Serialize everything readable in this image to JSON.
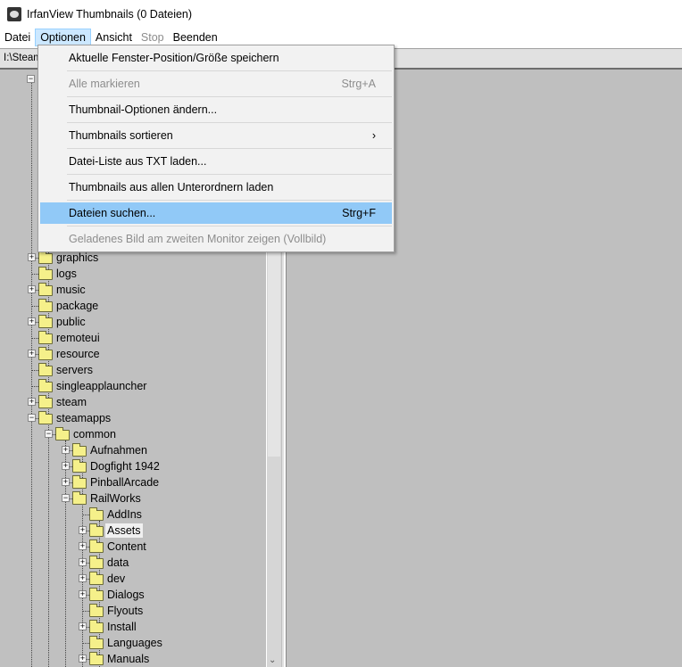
{
  "window": {
    "title": "IrfanView Thumbnails (0 Dateien)"
  },
  "menubar": [
    {
      "label": "Datei",
      "state": "normal"
    },
    {
      "label": "Optionen",
      "state": "open"
    },
    {
      "label": "Ansicht",
      "state": "normal"
    },
    {
      "label": "Stop",
      "state": "disabled"
    },
    {
      "label": "Beenden",
      "state": "normal"
    }
  ],
  "address": {
    "path": "I:\\Steam"
  },
  "options_menu": [
    {
      "label": "Aktuelle Fenster-Position/Größe speichern",
      "shortcut": "",
      "disabled": false
    },
    {
      "label": "Alle markieren",
      "shortcut": "Strg+A",
      "disabled": true
    },
    {
      "label": "Thumbnail-Optionen ändern...",
      "shortcut": "",
      "disabled": false
    },
    {
      "label": "Thumbnails sortieren",
      "shortcut": "›",
      "disabled": false,
      "submenu": true
    },
    {
      "label": "Datei-Liste aus TXT laden...",
      "shortcut": "",
      "disabled": false
    },
    {
      "label": "Thumbnails aus allen Unterordnern laden",
      "shortcut": "",
      "disabled": false
    },
    {
      "label": "Dateien suchen...",
      "shortcut": "Strg+F",
      "disabled": false,
      "highlighted": true
    },
    {
      "label": "Geladenes Bild am zweiten Monitor zeigen (Vollbild)",
      "shortcut": "",
      "disabled": true
    }
  ],
  "tree": [
    {
      "label": "graphics",
      "level": 1,
      "exp": "plus"
    },
    {
      "label": "logs",
      "level": 1,
      "exp": "none"
    },
    {
      "label": "music",
      "level": 1,
      "exp": "plus"
    },
    {
      "label": "package",
      "level": 1,
      "exp": "none"
    },
    {
      "label": "public",
      "level": 1,
      "exp": "plus"
    },
    {
      "label": "remoteui",
      "level": 1,
      "exp": "none"
    },
    {
      "label": "resource",
      "level": 1,
      "exp": "plus"
    },
    {
      "label": "servers",
      "level": 1,
      "exp": "none"
    },
    {
      "label": "singleapplauncher",
      "level": 1,
      "exp": "none"
    },
    {
      "label": "steam",
      "level": 1,
      "exp": "plus"
    },
    {
      "label": "steamapps",
      "level": 1,
      "exp": "minus"
    },
    {
      "label": "common",
      "level": 2,
      "exp": "minus"
    },
    {
      "label": "Aufnahmen",
      "level": 3,
      "exp": "plus"
    },
    {
      "label": "Dogfight 1942",
      "level": 3,
      "exp": "plus"
    },
    {
      "label": "PinballArcade",
      "level": 3,
      "exp": "plus"
    },
    {
      "label": "RailWorks",
      "level": 3,
      "exp": "minus"
    },
    {
      "label": "AddIns",
      "level": 4,
      "exp": "none"
    },
    {
      "label": "Assets",
      "level": 4,
      "exp": "plus",
      "selected": true
    },
    {
      "label": "Content",
      "level": 4,
      "exp": "plus"
    },
    {
      "label": "data",
      "level": 4,
      "exp": "plus"
    },
    {
      "label": "dev",
      "level": 4,
      "exp": "plus"
    },
    {
      "label": "Dialogs",
      "level": 4,
      "exp": "plus"
    },
    {
      "label": "Flyouts",
      "level": 4,
      "exp": "none"
    },
    {
      "label": "Install",
      "level": 4,
      "exp": "plus"
    },
    {
      "label": "Languages",
      "level": 4,
      "exp": "none"
    },
    {
      "label": "Manuals",
      "level": 4,
      "exp": "plus"
    }
  ]
}
